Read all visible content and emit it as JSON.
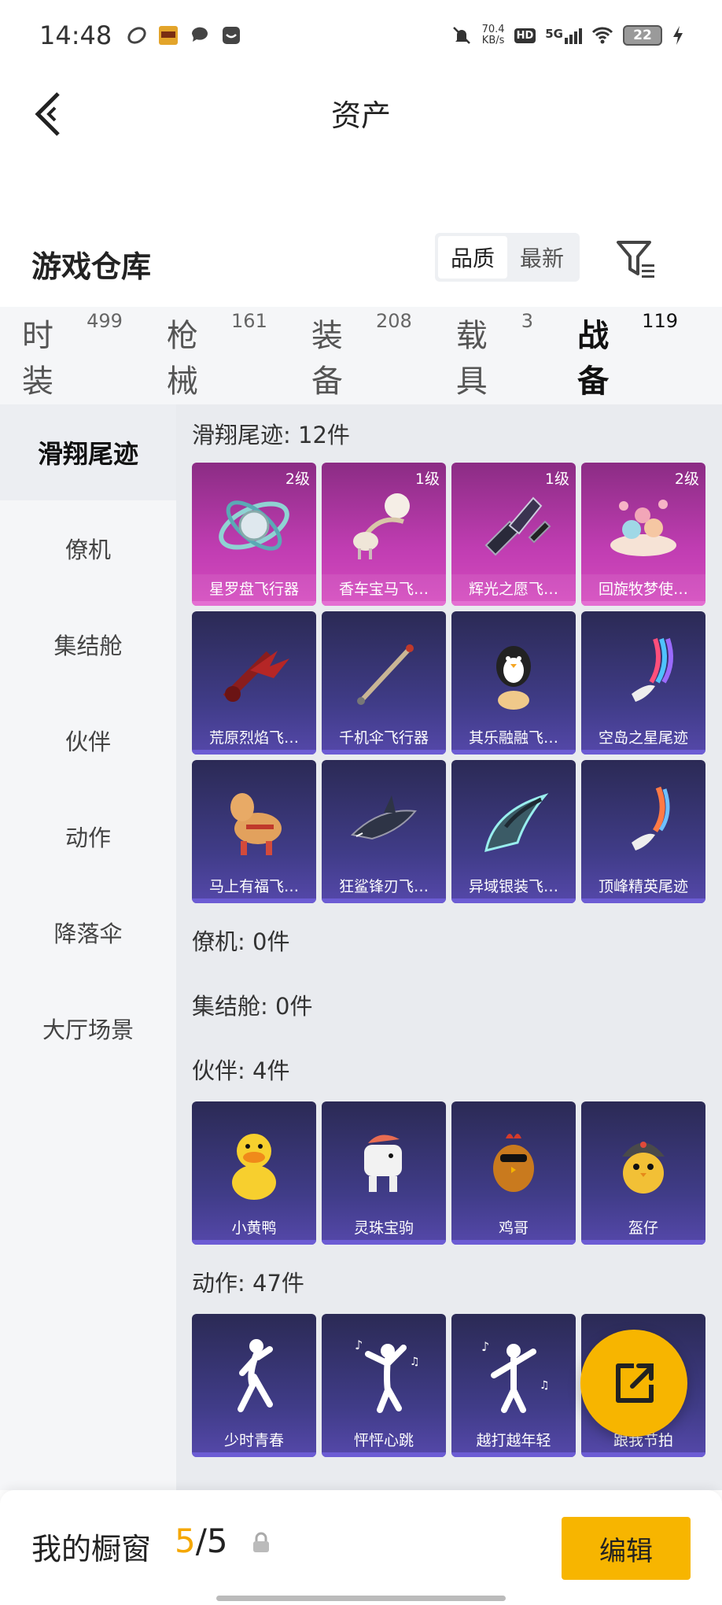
{
  "status_bar": {
    "time": "14:48",
    "net_speed_value": "70.4",
    "net_speed_unit": "KB/s",
    "hd": "HD",
    "signal": "5G",
    "battery": "22"
  },
  "header": {
    "title": "资产"
  },
  "warehouse": {
    "title": "游戏仓库",
    "sort_options": [
      "品质",
      "最新"
    ],
    "active_sort": "品质"
  },
  "tabs": [
    {
      "label": "时装",
      "count": "499"
    },
    {
      "label": "枪械",
      "count": "161"
    },
    {
      "label": "装备",
      "count": "208"
    },
    {
      "label": "载具",
      "count": "3"
    },
    {
      "label": "战备",
      "count": "119"
    }
  ],
  "sidebar": {
    "items": [
      {
        "label": "滑翔尾迹"
      },
      {
        "label": "僚机"
      },
      {
        "label": "集结舱"
      },
      {
        "label": "伙伴"
      },
      {
        "label": "动作"
      },
      {
        "label": "降落伞"
      },
      {
        "label": "大厅场景"
      }
    ]
  },
  "sections": {
    "glide": {
      "title": "滑翔尾迹: 12件",
      "items": [
        {
          "name": "星罗盘飞行器",
          "level": "2级",
          "art": "astrolabe-icon"
        },
        {
          "name": "香车宝马飞…",
          "level": "1级",
          "art": "carriage-icon"
        },
        {
          "name": "辉光之愿飞…",
          "level": "1级",
          "art": "crystal-icon"
        },
        {
          "name": "回旋牧梦使…",
          "level": "2级",
          "art": "carousel-icon"
        },
        {
          "name": "荒原烈焰飞…",
          "art": "flame-wings-icon"
        },
        {
          "name": "千机伞飞行器",
          "art": "umbrella-icon"
        },
        {
          "name": "其乐融融飞…",
          "art": "penguin-icon"
        },
        {
          "name": "空岛之星尾迹",
          "art": "rainbow-trail-icon"
        },
        {
          "name": "马上有福飞…",
          "art": "horse-toy-icon"
        },
        {
          "name": "狂鲨锋刃飞…",
          "art": "shark-icon"
        },
        {
          "name": "异域银装飞…",
          "art": "blade-wing-icon"
        },
        {
          "name": "顶峰精英尾迹",
          "art": "flame-trail-icon"
        }
      ]
    },
    "wingman": {
      "title": "僚机: 0件"
    },
    "pod": {
      "title": "集结舱: 0件"
    },
    "partner": {
      "title": "伙伴: 4件",
      "items": [
        {
          "name": "小黄鸭",
          "art": "duck-icon"
        },
        {
          "name": "灵珠宝驹",
          "art": "pony-icon"
        },
        {
          "name": "鸡哥",
          "art": "rooster-icon"
        },
        {
          "name": "盔仔",
          "art": "helmet-chick-icon"
        }
      ]
    },
    "emote": {
      "title": "动作: 47件",
      "items": [
        {
          "name": "少时青春",
          "art": "dance-icon"
        },
        {
          "name": "怦怦心跳",
          "art": "dance-icon"
        },
        {
          "name": "越打越年轻",
          "art": "dance-icon"
        },
        {
          "name": "跟我节拍",
          "art": "dance-icon"
        }
      ]
    }
  },
  "bottom": {
    "showcase_label": "我的橱窗",
    "showcase_current": "5",
    "showcase_sep": "/",
    "showcase_total": "5",
    "edit_label": "编辑"
  },
  "colors": {
    "accent": "#f7b500",
    "epic": "#c03db2",
    "rare": "#403c88"
  }
}
